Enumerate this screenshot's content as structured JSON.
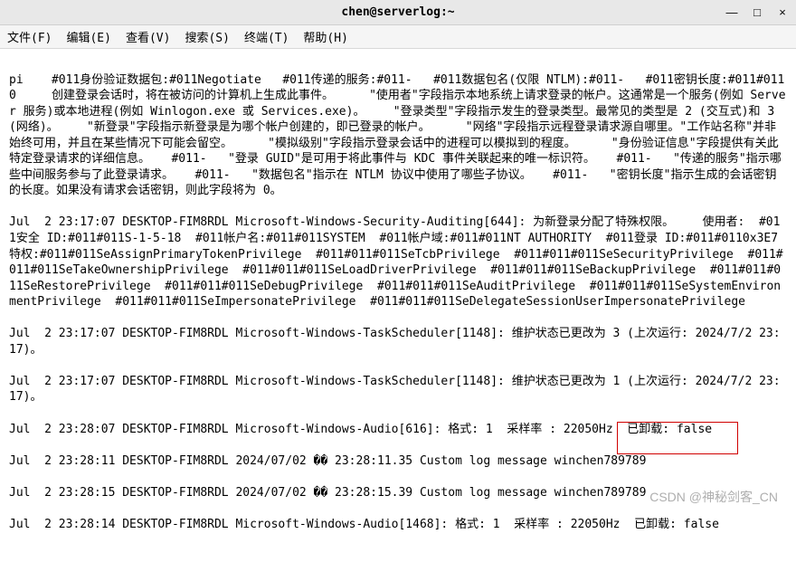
{
  "window": {
    "title": "chen@serverlog:~",
    "controls": {
      "min": "—",
      "max": "□",
      "close": "×"
    }
  },
  "menu": {
    "file": "文件(F)",
    "edit": "编辑(E)",
    "view": "查看(V)",
    "search": "搜索(S)",
    "terminal": "终端(T)",
    "help": "帮助(H)"
  },
  "log": {
    "block1": "pi    #011身份验证数据包:#011Negotiate   #011传递的服务:#011-   #011数据包名(仅限 NTLM):#011-   #011密钥长度:#011#0110     创建登录会话时，将在被访问的计算机上生成此事件。     \"使用者\"字段指示本地系统上请求登录的帐户。这通常是一个服务(例如 Server 服务)或本地进程(例如 Winlogon.exe 或 Services.exe)。    \"登录类型\"字段指示发生的登录类型。最常见的类型是 2 (交互式)和 3 (网络)。    \"新登录\"字段指示新登录是为哪个帐户创建的，即已登录的帐户。     \"网络\"字段指示远程登录请求源自哪里。\"工作站名称\"并非始终可用，并且在某些情况下可能会留空。     \"模拟级别\"字段指示登录会话中的进程可以模拟到的程度。     \"身份验证信息\"字段提供有关此特定登录请求的详细信息。   #011-   \"登录 GUID\"是可用于将此事件与 KDC 事件关联起来的唯一标识符。   #011-   \"传递的服务\"指示哪些中间服务参与了此登录请求。   #011-   \"数据包名\"指示在 NTLM 协议中使用了哪些子协议。   #011-   \"密钥长度\"指示生成的会话密钥的长度。如果没有请求会话密钥，则此字段将为 0。",
    "block2": "Jul  2 23:17:07 DESKTOP-FIM8RDL Microsoft-Windows-Security-Auditing[644]: 为新登录分配了特殊权限。    使用者:  #011安全 ID:#011#011S-1-5-18  #011帐户名:#011#011SYSTEM  #011帐户域:#011#011NT AUTHORITY  #011登录 ID:#011#0110x3E7    特权:#011#011SeAssignPrimaryTokenPrivilege  #011#011#011SeTcbPrivilege  #011#011#011SeSecurityPrivilege  #011#011#011SeTakeOwnershipPrivilege  #011#011#011SeLoadDriverPrivilege  #011#011#011SeBackupPrivilege  #011#011#011SeRestorePrivilege  #011#011#011SeDebugPrivilege  #011#011#011SeAuditPrivilege  #011#011#011SeSystemEnvironmentPrivilege  #011#011#011SeImpersonatePrivilege  #011#011#011SeDelegateSessionUserImpersonatePrivilege",
    "block3": "Jul  2 23:17:07 DESKTOP-FIM8RDL Microsoft-Windows-TaskScheduler[1148]: 维护状态已更改为 3 (上次运行: 2024/7/2 23:17)。",
    "block4": "Jul  2 23:17:07 DESKTOP-FIM8RDL Microsoft-Windows-TaskScheduler[1148]: 维护状态已更改为 1 (上次运行: 2024/7/2 23:17)。",
    "block5": "Jul  2 23:28:07 DESKTOP-FIM8RDL Microsoft-Windows-Audio[616]: 格式: 1  采样率 : 22050Hz  已卸载: false",
    "block6": "Jul  2 23:28:11 DESKTOP-FIM8RDL 2024/07/02 �� 23:28:11.35 Custom log message winchen789789",
    "block7": "Jul  2 23:28:15 DESKTOP-FIM8RDL 2024/07/02 �� 23:28:15.39 Custom log message winchen789789",
    "block8": "Jul  2 23:28:14 DESKTOP-FIM8RDL Microsoft-Windows-Audio[1468]: 格式: 1  采样率 : 22050Hz  已卸载: false"
  },
  "highlight": {
    "text": "winchen789789"
  },
  "watermark": "CSDN @神秘剑客_CN"
}
